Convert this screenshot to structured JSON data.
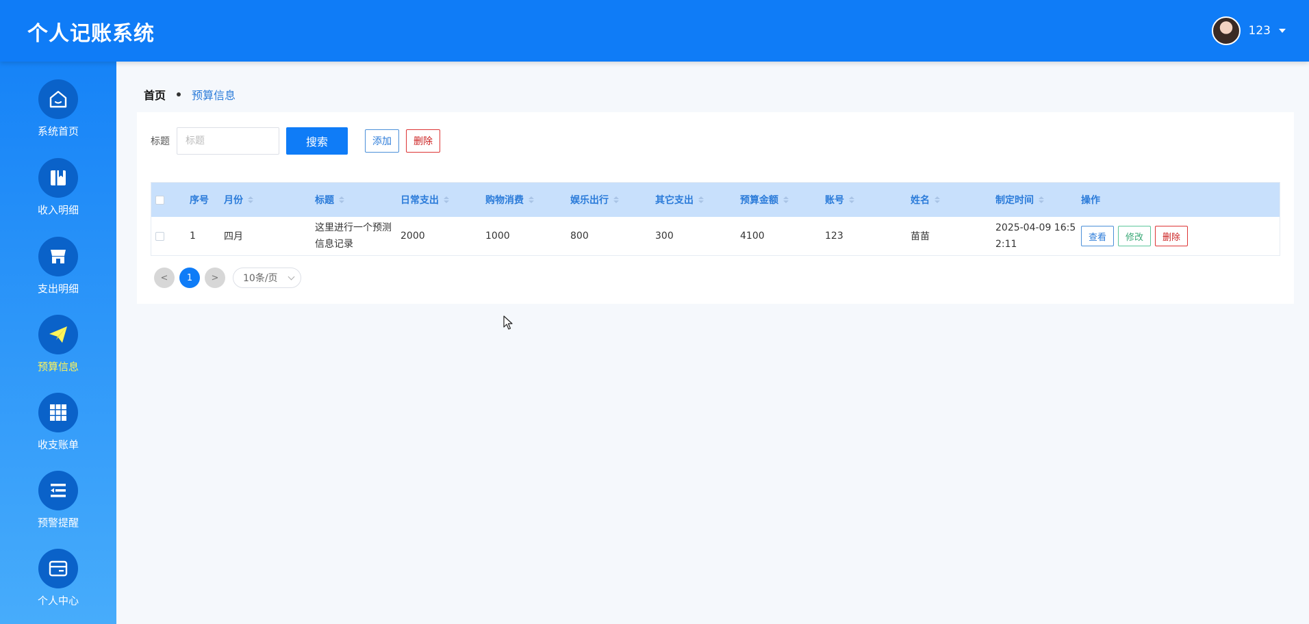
{
  "header": {
    "app_title": "个人记账系统",
    "user_name": "123"
  },
  "sidebar": {
    "items": [
      {
        "label": "系统首页",
        "icon": "home-icon",
        "active": false
      },
      {
        "label": "收入明细",
        "icon": "book-icon",
        "active": false
      },
      {
        "label": "支出明细",
        "icon": "store-icon",
        "active": false
      },
      {
        "label": "预算信息",
        "icon": "paper-plane-icon",
        "active": true
      },
      {
        "label": "收支账单",
        "icon": "grid-icon",
        "active": false
      },
      {
        "label": "预警提醒",
        "icon": "list-icon",
        "active": false
      },
      {
        "label": "个人中心",
        "icon": "card-icon",
        "active": false
      }
    ],
    "active_label_color": "#fff55a"
  },
  "breadcrumb": {
    "home": "首页",
    "current": "预算信息"
  },
  "search": {
    "label": "标题",
    "placeholder": "标题",
    "value": "",
    "search_button": "搜索",
    "add_button": "添加",
    "delete_button": "删除"
  },
  "table": {
    "columns": [
      "序号",
      "月份",
      "标题",
      "日常支出",
      "购物消费",
      "娱乐出行",
      "其它支出",
      "预算金额",
      "账号",
      "姓名",
      "制定时间",
      "操作"
    ],
    "rows": [
      {
        "index": "1",
        "month": "四月",
        "title": "这里进行一个预测信息记录",
        "daily": "2000",
        "shopping": "1000",
        "entertainment": "800",
        "other": "300",
        "budget": "4100",
        "account": "123",
        "name": "苗苗",
        "created": "2025-04-09 16:52:11"
      }
    ],
    "actions": {
      "view": "查看",
      "edit": "修改",
      "delete": "删除"
    }
  },
  "pagination": {
    "prev": "<",
    "current_page": "1",
    "next": ">",
    "page_size": "10条/页"
  },
  "colors": {
    "primary": "#0f7cf7",
    "header_bg": "#0f7cf7",
    "table_header_bg": "#c8e0fc",
    "danger": "#cc2222",
    "success": "#3aa876"
  }
}
